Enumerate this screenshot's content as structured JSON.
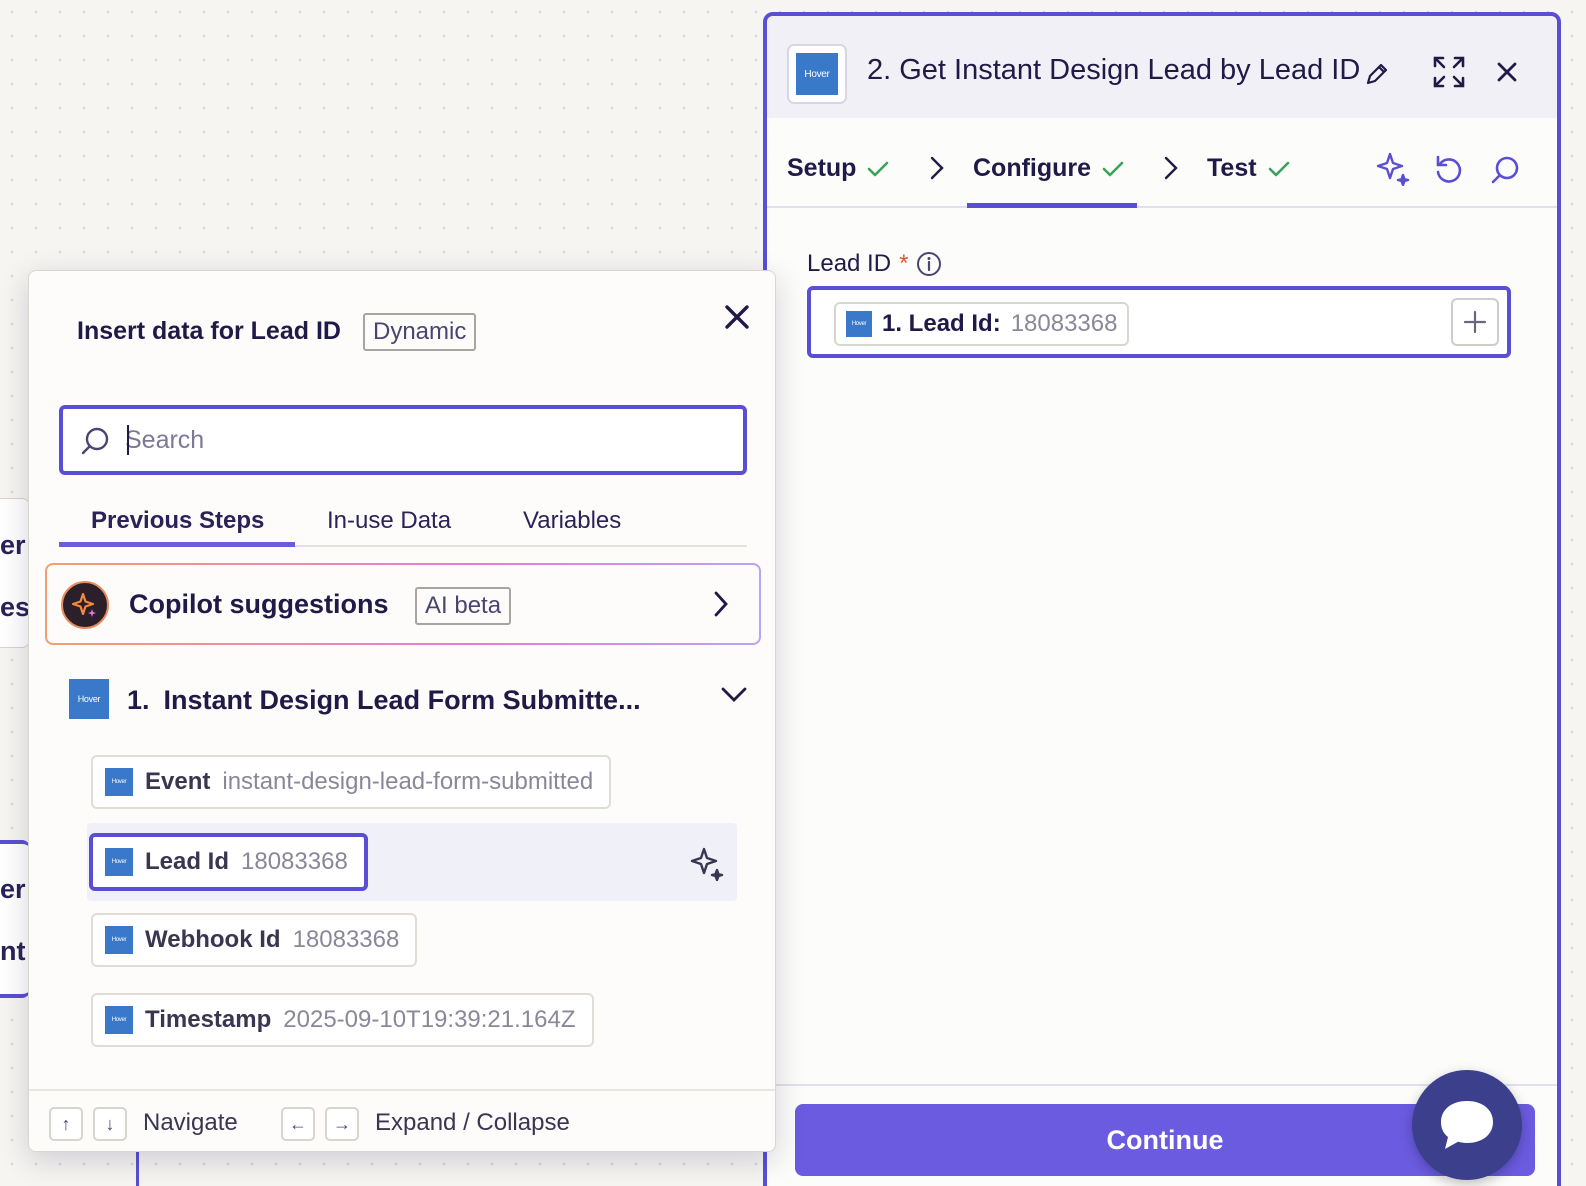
{
  "step_panel": {
    "title": "2. Get Instant Design Lead by Lead ID",
    "app_logo_text": "Hover",
    "tabs": [
      {
        "label": "Setup",
        "status": "complete"
      },
      {
        "label": "Configure",
        "status": "complete",
        "active": true
      },
      {
        "label": "Test",
        "status": "complete"
      }
    ],
    "field": {
      "label": "Lead ID",
      "required_mark": "*",
      "value_key": "1. Lead Id:",
      "value": "18083368"
    },
    "continue_label": "Continue"
  },
  "popover": {
    "title": "Insert data for Lead ID",
    "badge": "Dynamic",
    "search_placeholder": "Search",
    "tabs": [
      {
        "label": "Previous Steps",
        "active": true
      },
      {
        "label": "In-use Data"
      },
      {
        "label": "Variables"
      }
    ],
    "copilot": {
      "label": "Copilot suggestions",
      "badge": "AI beta"
    },
    "step": {
      "number": "1.",
      "label": "Instant Design Lead Form Submitte...",
      "logo_text": "Hover"
    },
    "items": [
      {
        "key": "Event",
        "value": "instant-design-lead-form-submitted"
      },
      {
        "key": "Lead Id",
        "value": "18083368",
        "selected": true
      },
      {
        "key": "Webhook Id",
        "value": "18083368"
      },
      {
        "key": "Timestamp",
        "value": "2025-09-10T19:39:21.164Z"
      }
    ],
    "footer": {
      "navigate_keys": [
        "↑",
        "↓"
      ],
      "navigate_label": "Navigate",
      "expand_keys": [
        "←",
        "→"
      ],
      "expand_label": "Expand / Collapse"
    }
  },
  "background_fragments": [
    "er",
    "es",
    "er",
    "nt"
  ],
  "colors": {
    "accent": "#5a4fd4",
    "continue": "#6b5be0",
    "check": "#3aa35a",
    "app_logo": "#3a78c9",
    "chat": "#3b3f8c"
  }
}
